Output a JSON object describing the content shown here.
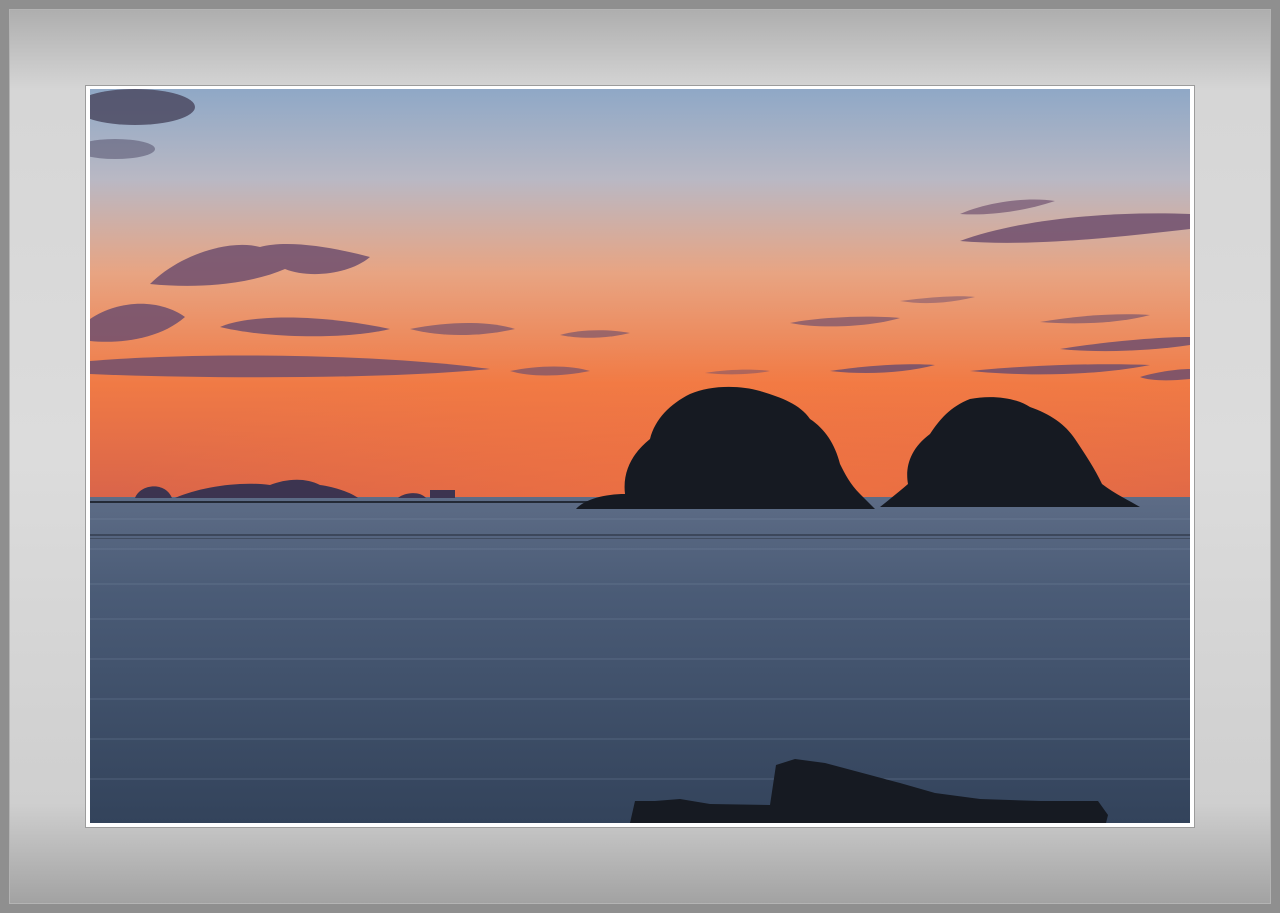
{
  "scene": {
    "subject": "sunset-over-sea-with-two-wooded-islets",
    "colors": {
      "sky_top": "#93a9c4",
      "sky_mid": "#d9a99a",
      "sky_horizon": "#ee6f3e",
      "sea": "#3f4f66",
      "silhouette": "#161a22",
      "frame": "#d3d3d3",
      "mat": "#ffffff"
    }
  }
}
